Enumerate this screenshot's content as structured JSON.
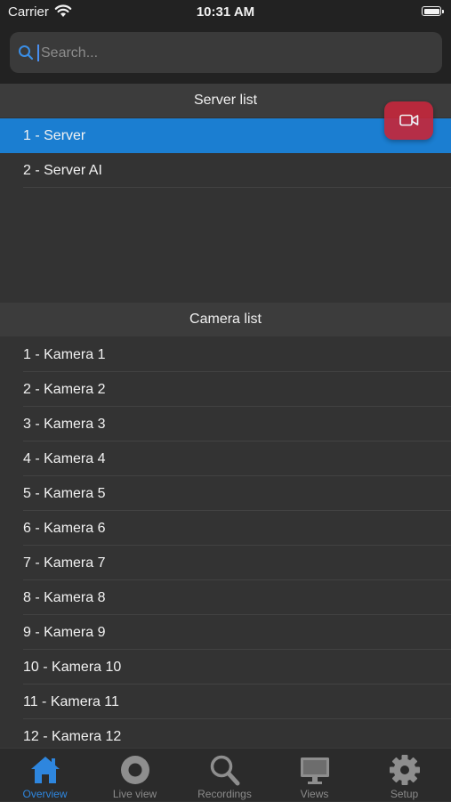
{
  "status_bar": {
    "carrier": "Carrier",
    "time": "10:31 AM"
  },
  "search": {
    "placeholder": "Search..."
  },
  "server_section": {
    "title": "Server list",
    "items": [
      {
        "label": "1 - Server",
        "selected": true
      },
      {
        "label": "2 - Server AI",
        "selected": false
      }
    ]
  },
  "camera_section": {
    "title": "Camera list",
    "items": [
      {
        "label": "1 - Kamera 1"
      },
      {
        "label": "2 - Kamera 2"
      },
      {
        "label": "3 - Kamera 3"
      },
      {
        "label": "4 - Kamera 4"
      },
      {
        "label": "5 - Kamera 5"
      },
      {
        "label": "6 - Kamera 6"
      },
      {
        "label": "7 - Kamera 7"
      },
      {
        "label": "8 - Kamera 8"
      },
      {
        "label": "9 - Kamera 9"
      },
      {
        "label": "10 - Kamera 10"
      },
      {
        "label": "11 - Kamera 11"
      },
      {
        "label": "12 - Kamera 12"
      }
    ]
  },
  "fab": {
    "icon": "video-camera-icon",
    "color": "#c3283c"
  },
  "tabbar": {
    "active_color": "#2e86de",
    "tabs": [
      {
        "label": "Overview",
        "icon": "home-icon",
        "active": true
      },
      {
        "label": "Live view",
        "icon": "record-icon",
        "active": false
      },
      {
        "label": "Recordings",
        "icon": "search-icon",
        "active": false
      },
      {
        "label": "Views",
        "icon": "monitor-icon",
        "active": false
      },
      {
        "label": "Setup",
        "icon": "gear-icon",
        "active": false
      }
    ]
  }
}
